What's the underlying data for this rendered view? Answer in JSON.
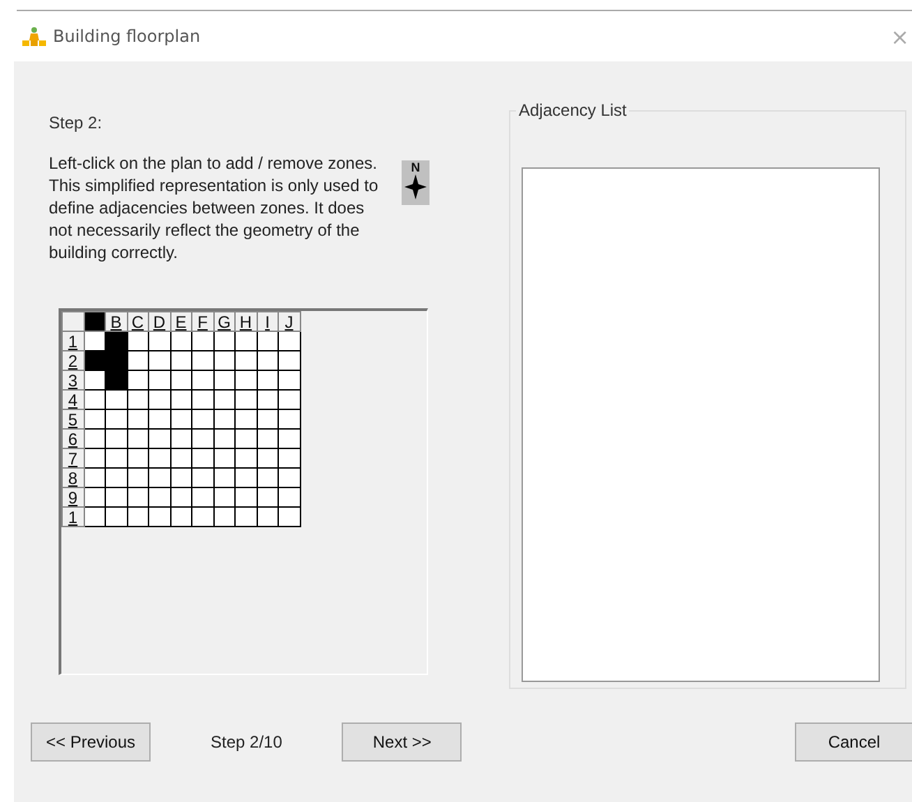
{
  "window": {
    "title": "Building floorplan",
    "close": "×"
  },
  "step_heading": "Step 2:",
  "instructions": "Left-click on the plan to add / remove zones. This simplified representation is only used to define adjacencies between zones. It does not necessarily reflect the geometry of the building correctly.",
  "compass": {
    "label": "N"
  },
  "grid": {
    "columns": [
      {
        "highlighted": true
      },
      {
        "label": "B",
        "highlighted": false
      },
      {
        "label": "C",
        "highlighted": false
      },
      {
        "label": "D",
        "highlighted": false
      },
      {
        "label": "E",
        "highlighted": false
      },
      {
        "label": "F",
        "highlighted": false
      },
      {
        "label": "G",
        "highlighted": false
      },
      {
        "label": "H",
        "highlighted": false
      },
      {
        "label": "I",
        "highlighted": false
      },
      {
        "label": "J",
        "highlighted": false
      }
    ],
    "rows": [
      {
        "label": "1",
        "filled": [
          false,
          true,
          false,
          false,
          false,
          false,
          false,
          false,
          false,
          false
        ]
      },
      {
        "label": "2",
        "filled": [
          true,
          true,
          false,
          false,
          false,
          false,
          false,
          false,
          false,
          false
        ]
      },
      {
        "label": "3",
        "filled": [
          false,
          true,
          false,
          false,
          false,
          false,
          false,
          false,
          false,
          false
        ]
      },
      {
        "label": "4",
        "filled": [
          false,
          false,
          false,
          false,
          false,
          false,
          false,
          false,
          false,
          false
        ]
      },
      {
        "label": "5",
        "filled": [
          false,
          false,
          false,
          false,
          false,
          false,
          false,
          false,
          false,
          false
        ]
      },
      {
        "label": "6",
        "filled": [
          false,
          false,
          false,
          false,
          false,
          false,
          false,
          false,
          false,
          false
        ]
      },
      {
        "label": "7",
        "filled": [
          false,
          false,
          false,
          false,
          false,
          false,
          false,
          false,
          false,
          false
        ]
      },
      {
        "label": "8",
        "filled": [
          false,
          false,
          false,
          false,
          false,
          false,
          false,
          false,
          false,
          false
        ]
      },
      {
        "label": "9",
        "filled": [
          false,
          false,
          false,
          false,
          false,
          false,
          false,
          false,
          false,
          false
        ]
      },
      {
        "label": "1",
        "filled": [
          false,
          false,
          false,
          false,
          false,
          false,
          false,
          false,
          false,
          false
        ]
      }
    ]
  },
  "adjacency_list": {
    "title": "Adjacency List"
  },
  "footer": {
    "previous": "<< Previous",
    "step": "Step 2/10",
    "next": "Next >>",
    "cancel": "Cancel"
  }
}
